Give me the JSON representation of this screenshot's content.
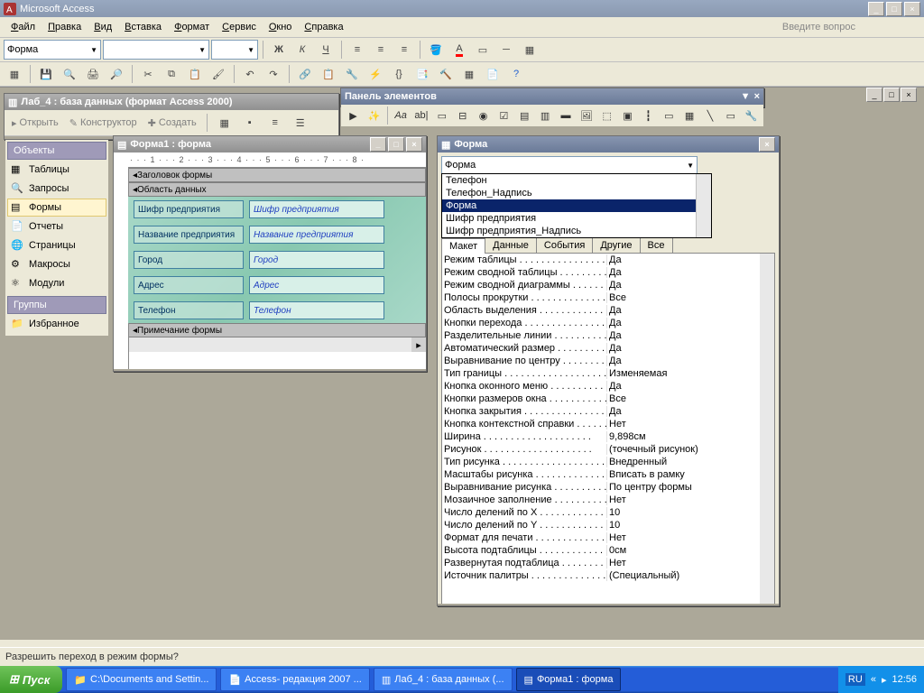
{
  "app_title": "Microsoft Access",
  "menus": [
    "Файл",
    "Правка",
    "Вид",
    "Вставка",
    "Формат",
    "Сервис",
    "Окно",
    "Справка"
  ],
  "help_placeholder": "Введите вопрос",
  "format_combo": "Форма",
  "db_window": {
    "title": "Лаб_4 : база данных (формат Access 2000)",
    "toolbar": {
      "open": "Открыть",
      "design": "Конструктор",
      "create": "Создать"
    },
    "objects_header": "Объекты",
    "groups_header": "Группы",
    "items": [
      "Таблицы",
      "Запросы",
      "Формы",
      "Отчеты",
      "Страницы",
      "Макросы",
      "Модули"
    ],
    "selected_index": 2,
    "favorites": "Избранное"
  },
  "form_design": {
    "title": "Форма1 : форма",
    "sections": {
      "header": "Заголовок формы",
      "detail": "Область данных",
      "footer": "Примечание формы"
    },
    "fields": [
      {
        "label": "Шифр предприятия",
        "bound": "Шифр предприятия"
      },
      {
        "label": "Название предприятия",
        "bound": "Название предприятия"
      },
      {
        "label": "Город",
        "bound": "Город"
      },
      {
        "label": "Адрес",
        "bound": "Адрес"
      },
      {
        "label": "Телефон",
        "bound": "Телефон"
      }
    ],
    "ruler_text": "· · · 1 · · · 2 · · · 3 · · · 4 · · · 5 · · · 6 · · · 7 · · · 8 ·"
  },
  "toolbox": {
    "title": "Панель элементов"
  },
  "properties": {
    "title": "Форма",
    "selector": "Форма",
    "dropdown_options": [
      "Телефон",
      "Телефон_Надпись",
      "Форма",
      "Шифр предприятия",
      "Шифр предприятия_Надпись"
    ],
    "dropdown_selected_index": 2,
    "tabs": [
      "Макет",
      "Данные",
      "События",
      "Другие",
      "Все"
    ],
    "active_tab": 0,
    "rows": [
      {
        "n": "Режим таблицы",
        "v": "Да"
      },
      {
        "n": "Режим сводной таблицы",
        "v": "Да"
      },
      {
        "n": "Режим сводной диаграммы",
        "v": "Да"
      },
      {
        "n": "Полосы прокрутки",
        "v": "Все"
      },
      {
        "n": "Область выделения",
        "v": "Да"
      },
      {
        "n": "Кнопки перехода",
        "v": "Да"
      },
      {
        "n": "Разделительные линии",
        "v": "Да"
      },
      {
        "n": "Автоматический размер",
        "v": "Да"
      },
      {
        "n": "Выравнивание по центру",
        "v": "Да"
      },
      {
        "n": "Тип границы",
        "v": "Изменяемая"
      },
      {
        "n": "Кнопка оконного меню",
        "v": "Да"
      },
      {
        "n": "Кнопки размеров окна",
        "v": "Все"
      },
      {
        "n": "Кнопка закрытия",
        "v": "Да"
      },
      {
        "n": "Кнопка контекстной справки",
        "v": "Нет"
      },
      {
        "n": "Ширина",
        "v": "9,898см"
      },
      {
        "n": "Рисунок",
        "v": "(точечный рисунок)"
      },
      {
        "n": "Тип рисунка",
        "v": "Внедренный"
      },
      {
        "n": "Масштабы рисунка",
        "v": "Вписать в рамку"
      },
      {
        "n": "Выравнивание рисунка",
        "v": "По центру формы"
      },
      {
        "n": "Мозаичное заполнение",
        "v": "Нет"
      },
      {
        "n": "Число делений по X",
        "v": "10"
      },
      {
        "n": "Число делений по Y",
        "v": "10"
      },
      {
        "n": "Формат для печати",
        "v": "Нет"
      },
      {
        "n": "Высота подтаблицы",
        "v": "0см"
      },
      {
        "n": "Развернутая подтаблица",
        "v": "Нет"
      },
      {
        "n": "Источник палитры",
        "v": "(Специальный)"
      }
    ]
  },
  "status_text": "Разрешить переход в режим формы?",
  "taskbar": {
    "start": "Пуск",
    "items": [
      "C:\\Documents and Settin...",
      "Access- редакция 2007 ...",
      "Лаб_4 : база данных (...",
      "Форма1 : форма"
    ],
    "active_index": 3,
    "lang": "RU",
    "clock": "12:56"
  }
}
